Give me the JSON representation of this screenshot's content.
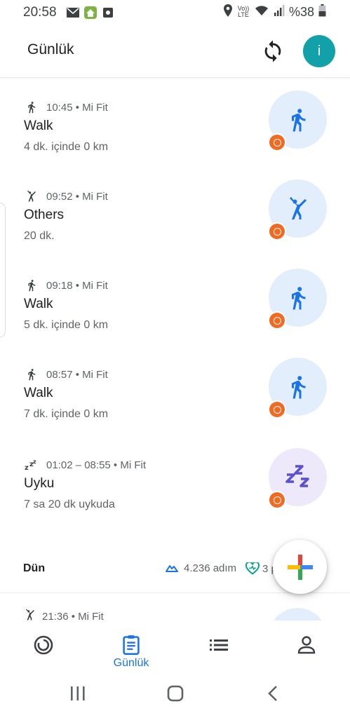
{
  "status_bar": {
    "time": "20:58",
    "battery": "%38",
    "network": "Vo)) LTE"
  },
  "app_bar": {
    "title": "Günlük",
    "avatar_letter": "i"
  },
  "activities": [
    {
      "icon": "walk-icon",
      "meta": "10:45 • Mi Fit",
      "title": "Walk",
      "subtitle": "4 dk. içinde 0 km"
    },
    {
      "icon": "others-icon",
      "meta": "09:52 • Mi Fit",
      "title": "Others",
      "subtitle": "20 dk."
    },
    {
      "icon": "walk-icon",
      "meta": "09:18 • Mi Fit",
      "title": "Walk",
      "subtitle": "5 dk. içinde 0 km"
    },
    {
      "icon": "walk-icon",
      "meta": "08:57 • Mi Fit",
      "title": "Walk",
      "subtitle": "7 dk. içinde 0 km"
    },
    {
      "icon": "sleep-icon",
      "meta": "01:02 – 08:55 • Mi Fit",
      "title": "Uyku",
      "subtitle": "7 sa 20 dk uykuda"
    }
  ],
  "day_summary": {
    "label": "Dün",
    "steps": "4.236 adım",
    "heart_points": "3 p"
  },
  "peek_row": {
    "meta": "21:36 • Mi Fit"
  },
  "bottom_nav": {
    "items": [
      {
        "name": "home",
        "label": ""
      },
      {
        "name": "journal",
        "label": "Günlük",
        "selected": true
      },
      {
        "name": "browse",
        "label": ""
      },
      {
        "name": "profile",
        "label": ""
      }
    ]
  },
  "colors": {
    "accent": "#1a73e8",
    "walk_circle": "#e3eefc",
    "sleep_circle": "#ede9fb",
    "mi_fit": "#f26a21",
    "avatar": "#12a1a9"
  }
}
